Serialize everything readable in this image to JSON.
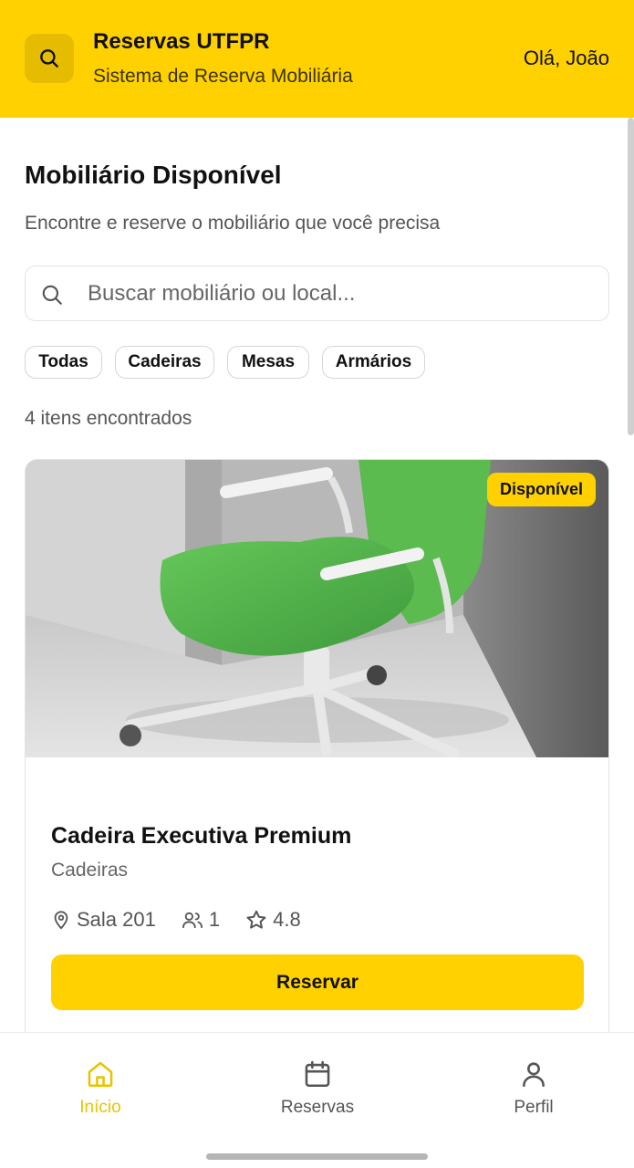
{
  "header": {
    "title": "Reservas UTFPR",
    "subtitle": "Sistema de Reserva Mobiliária",
    "greeting": "Olá, João",
    "accent_color": "#FFD100"
  },
  "main": {
    "title": "Mobiliário Disponível",
    "description": "Encontre e reserve o mobiliário que você precisa",
    "search": {
      "placeholder": "Buscar mobiliário ou local...",
      "value": ""
    },
    "filters": [
      "Todas",
      "Cadeiras",
      "Mesas",
      "Armários"
    ],
    "result_count": "4 itens encontrados"
  },
  "items": [
    {
      "status": "Disponível",
      "name": "Cadeira Executiva Premium",
      "category": "Cadeiras",
      "location": "Sala 201",
      "capacity": "1",
      "rating": "4.8",
      "action": "Reservar",
      "image_icon": "green-office-chair"
    }
  ],
  "bottom_nav": {
    "items": [
      {
        "label": "Início",
        "icon": "home-icon",
        "active": true
      },
      {
        "label": "Reservas",
        "icon": "calendar-icon",
        "active": false
      },
      {
        "label": "Perfil",
        "icon": "user-icon",
        "active": false
      }
    ],
    "active_color": "#E8C400",
    "inactive_color": "#555555"
  }
}
